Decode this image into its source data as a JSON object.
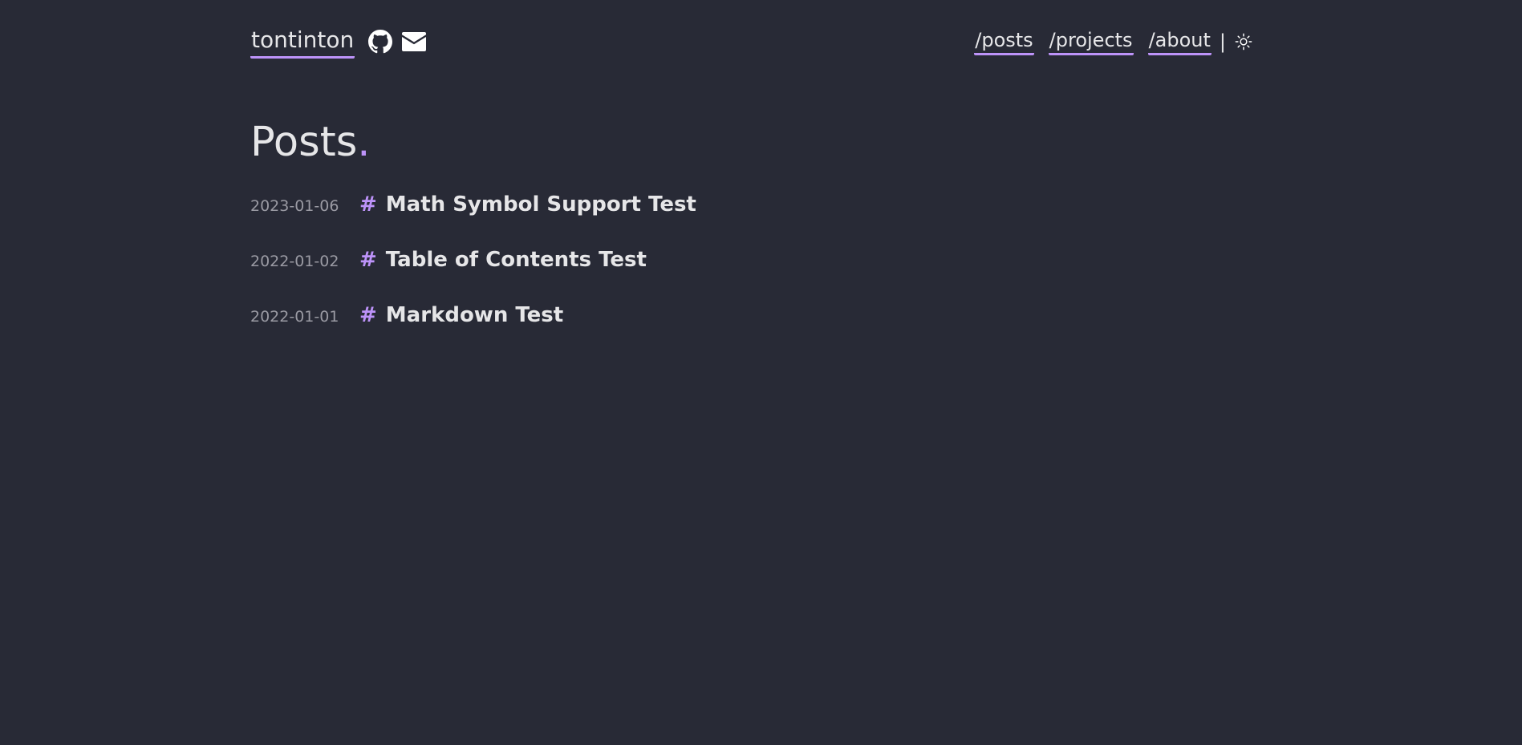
{
  "header": {
    "site_title": "tontinton",
    "social": [
      {
        "icon": "github-icon"
      },
      {
        "icon": "envelope-icon"
      }
    ],
    "nav": [
      {
        "label": "/posts"
      },
      {
        "label": "/projects"
      },
      {
        "label": "/about"
      }
    ],
    "separator": "|",
    "theme_toggle_icon": "sun-icon"
  },
  "main": {
    "heading": "Posts",
    "heading_accent": ".",
    "posts": [
      {
        "date": "2023-01-06",
        "hash": "#",
        "title": "Math Symbol Support Test"
      },
      {
        "date": "2022-01-02",
        "hash": "#",
        "title": "Table of Contents Test"
      },
      {
        "date": "2022-01-01",
        "hash": "#",
        "title": "Markdown Test"
      }
    ]
  },
  "colors": {
    "background": "#282a36",
    "accent": "#bd93f9",
    "text": "#e6e6e8",
    "muted": "#9a9aa3"
  }
}
